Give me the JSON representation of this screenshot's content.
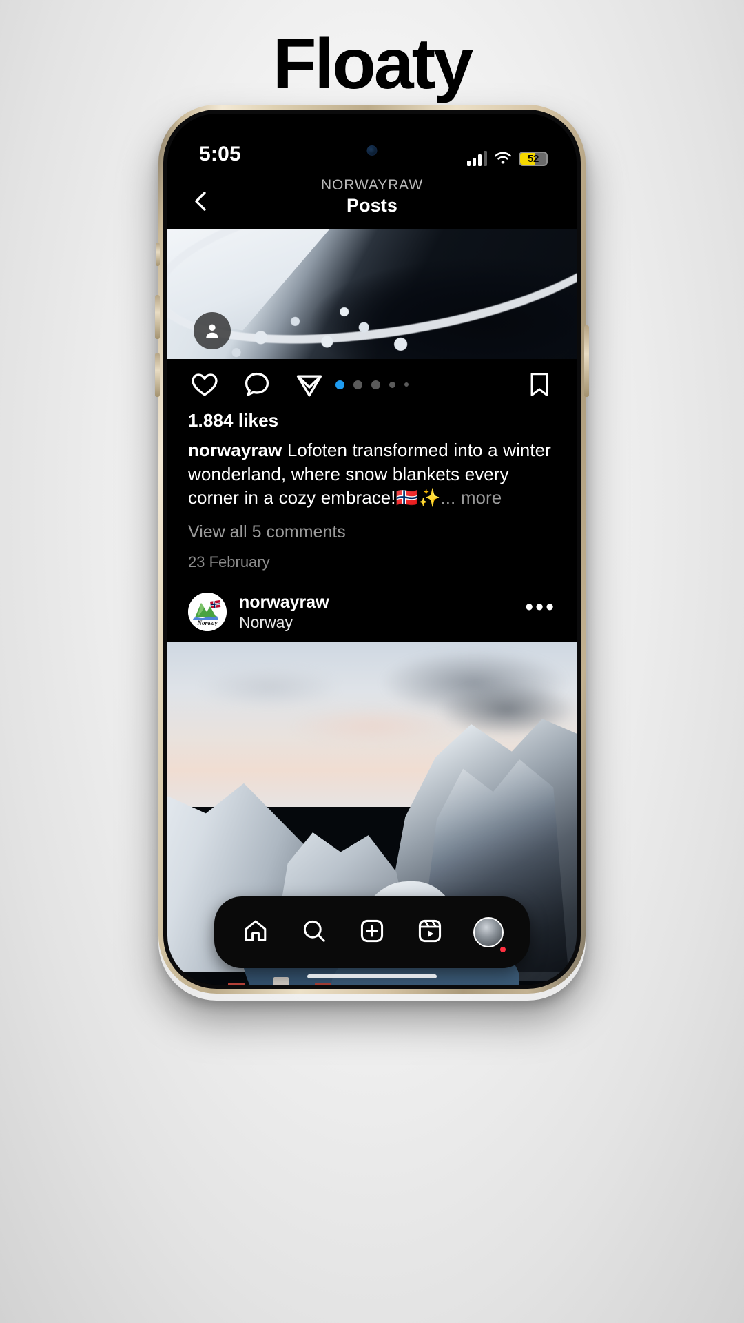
{
  "brand": {
    "name": "Floaty"
  },
  "status_bar": {
    "time": "5:05",
    "battery_percent": "52",
    "icons": [
      "cellular-signal-icon",
      "wifi-icon",
      "battery-icon"
    ]
  },
  "header": {
    "back_icon": "chevron-left-icon",
    "account": "NORWAYRAW",
    "title": "Posts"
  },
  "posts": [
    {
      "media": "aerial-snowy-coastline-photo",
      "tag_icon": "person-tag-icon",
      "actions": {
        "like": "heart-icon",
        "comment": "comment-bubble-icon",
        "share": "share-paper-plane-icon",
        "save": "bookmark-icon"
      },
      "carousel": {
        "total": 5,
        "active_index": 0
      },
      "likes": "1.884 likes",
      "caption_username": "norwayraw",
      "caption_text": " Lofoten transformed into a winter wonderland, where snow blankets every corner in a cozy embrace!🇳🇴✨",
      "caption_more": "... more",
      "comments_link": "View all 5 comments",
      "date": "23 February"
    },
    {
      "avatar": "norway-mountains-logo-avatar",
      "avatar_label": "Norway",
      "username": "norwayraw",
      "location": "Norway",
      "more_icon": "more-options-icon",
      "media": "lofoten-fjord-village-winter-photo"
    }
  ],
  "bottom_nav": {
    "items": [
      {
        "icon": "home-icon",
        "name": "home"
      },
      {
        "icon": "search-icon",
        "name": "search"
      },
      {
        "icon": "create-icon",
        "name": "create"
      },
      {
        "icon": "reels-icon",
        "name": "reels"
      },
      {
        "icon": "profile-avatar-icon",
        "name": "profile"
      }
    ]
  },
  "colors": {
    "accent_blue": "#1e9bf0",
    "battery_yellow": "#f5d800",
    "notification_red": "#ff3040",
    "app_background": "#000000"
  }
}
